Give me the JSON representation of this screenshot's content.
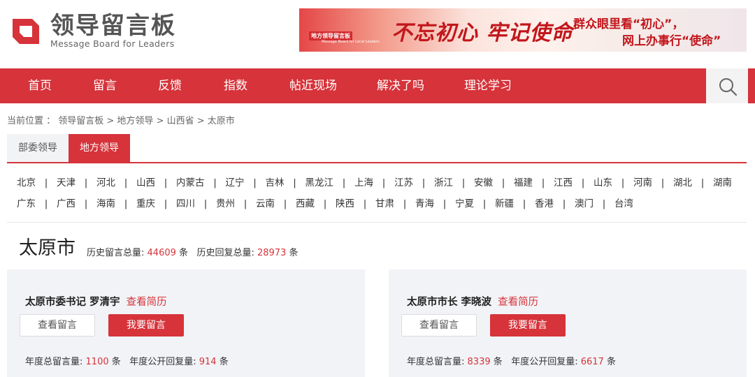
{
  "logo": {
    "title": "领导留言板",
    "subtitle": "Message Board for Leaders"
  },
  "banner": {
    "badge": "地方领导留言板",
    "badge_sub": "Message Board for Local Leaders",
    "slogan": "不忘初心 牢记使命",
    "line1": "群众眼里看“初心”，",
    "line2": "网上办事行“使命”"
  },
  "nav": {
    "items": [
      "首页",
      "留言",
      "反馈",
      "指数",
      "帖近现场",
      "解决了吗",
      "理论学习"
    ]
  },
  "breadcrumb": "当前位置 ： 领导留言板 > 地方领导 > 山西省 > 太原市",
  "tabs": [
    "部委领导",
    "地方领导"
  ],
  "provinces": {
    "row1": [
      "北京",
      "天津",
      "河北",
      "山西",
      "内蒙古",
      "辽宁",
      "吉林",
      "黑龙江",
      "上海",
      "江苏",
      "浙江",
      "安徽",
      "福建",
      "江西",
      "山东",
      "河南",
      "湖北",
      "湖南"
    ],
    "row2": [
      "广东",
      "广西",
      "海南",
      "重庆",
      "四川",
      "贵州",
      "云南",
      "西藏",
      "陕西",
      "甘肃",
      "青海",
      "宁夏",
      "新疆",
      "香港",
      "澳门",
      "台湾"
    ]
  },
  "city": {
    "name": "太原市",
    "history_total_label": "历史留言总量:",
    "history_total": "44609",
    "history_reply_label": "历史回复总量:",
    "history_reply": "28973",
    "unit": "条"
  },
  "leaders": [
    {
      "title": "太原市委书记 罗清宇",
      "resume": "查看简历",
      "view_btn": "查看留言",
      "post_btn": "我要留言",
      "year_total_label": "年度总留言量:",
      "year_total": "1100",
      "year_reply_label": "年度公开回复量:",
      "year_reply": "914",
      "unit": "条"
    },
    {
      "title": "太原市市长 李晓波",
      "resume": "查看简历",
      "view_btn": "查看留言",
      "post_btn": "我要留言",
      "year_total_label": "年度总留言量:",
      "year_total": "8339",
      "year_reply_label": "年度公开回复量:",
      "year_reply": "6617",
      "unit": "条"
    }
  ],
  "colors": {
    "accent": "#d6333a",
    "card_bg": "#f1f3f6"
  }
}
